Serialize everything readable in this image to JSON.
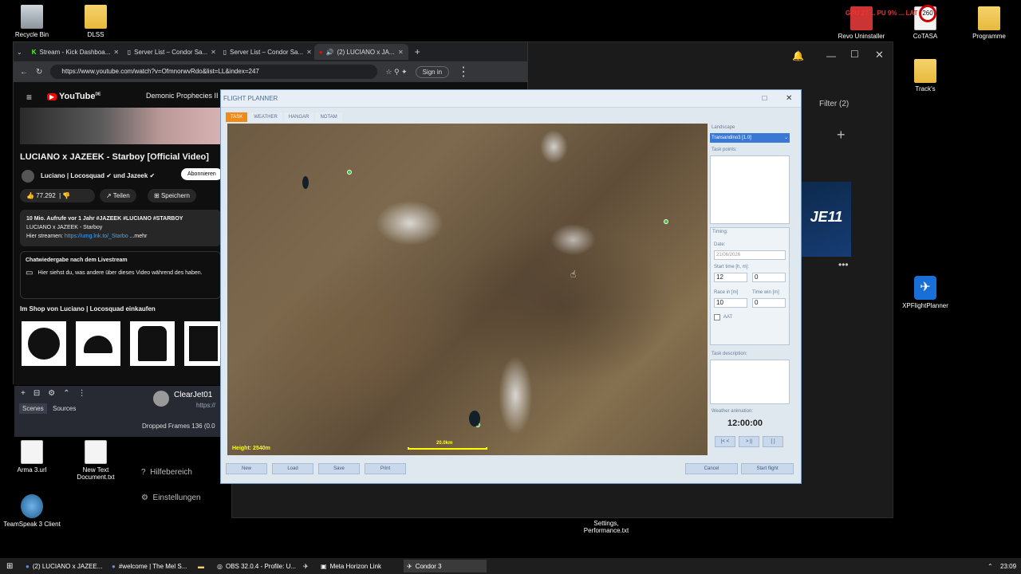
{
  "desktop": {
    "icons_left": [
      "Recycle Bin",
      "DLSS",
      "Arma 3.url",
      "New Text Document.txt",
      "TeamSpeak 3 Client"
    ],
    "icons_top_right": [
      "Revo Uninstaller",
      "CoTASA",
      "Programme"
    ],
    "icons_right": [
      "Track's",
      "XPFlightPlanner"
    ],
    "settings_file": "Settings, Performance.txt",
    "overlay_stats": "GPU 27 ... PU 9% ... LAT N/A",
    "badge_number": "260"
  },
  "browser": {
    "tabs": [
      {
        "label": "Stream - Kick Dashboa..."
      },
      {
        "label": "Server List – Condor Sa..."
      },
      {
        "label": "Server List – Condor Sa..."
      },
      {
        "label": "(2) LUCIANO x JA..."
      }
    ],
    "url": "https://www.youtube.com/watch?v=OfmnorwvRdo&list=LL&index=247",
    "sign_in": "Sign in"
  },
  "youtube": {
    "logo": "YouTube",
    "logo_region": "DE",
    "playlist_title": "Demonic Prophecies II",
    "video_title": "LUCIANO x JAZEEK - Starboy [Official Video]",
    "channel": "Luciano | Locosquad ✔ und Jazeek ✔",
    "subscribe": "Abonnieren",
    "likes": "77.292",
    "share": "Teilen",
    "save": "Speichern",
    "desc_line1": "10 Mio. Aufrufe  vor 1 Jahr  #JAZEEK #LUCIANO #STARBOY",
    "desc_line2": "LUCIANO x JAZEEK - Starboy",
    "desc_line3_prefix": "Hier streamen: ",
    "desc_link": "https://umg.lnk.to/_Starbo",
    "desc_more": "...mehr",
    "chat_replay_title": "Chatwiedergabe nach dem Livestream",
    "chat_replay_text": "Hier siehst du, was andere über dieses Video während des haben.",
    "shop_title": "Im Shop von Luciano | Locosquad einkaufen"
  },
  "obs": {
    "scenes": "Scenes",
    "sources": "Sources",
    "dropped_frames": "Dropped Frames 136 (0.0",
    "chat_user": "ClearJet01",
    "chat_link": "https://"
  },
  "darkapp": {
    "filter": "Filter (2)",
    "banner_text": "JE11",
    "help": "Hilfebereich",
    "settings": "Einstellungen"
  },
  "flight_planner": {
    "title": "FLIGHT PLANNER",
    "tabs": [
      "TASK",
      "WEATHER",
      "HANGAR",
      "NOTAM"
    ],
    "map_height": "Height: 2540m",
    "map_scale": "20.0km",
    "landscape_label": "Landscape",
    "landscape_value": "Transandino3 [1.0]",
    "task_points_label": "Task points:",
    "timing_label": "Timing:",
    "date_label": "Date:",
    "date_value": "21/06/2026",
    "start_time_label": "Start time [h, m]:",
    "start_h": "12",
    "start_m": "0",
    "race_in_label": "Race in [m]",
    "race_in_value": "10",
    "time_win_label": "Time win [m]",
    "time_win_value": "0",
    "aat_label": "AAT",
    "task_desc_label": "Task description:",
    "weather_anim_label": "Weather animation:",
    "weather_time": "12:00:00",
    "anim_buttons": [
      "|< <",
      "> ||",
      "[ ]"
    ],
    "buttons": {
      "new": "New",
      "load": "Load",
      "save": "Save",
      "print": "Print",
      "cancel": "Cancel",
      "start_flight": "Start flight"
    }
  },
  "taskbar": {
    "items": [
      "(2) LUCIANO x JAZEE...",
      "#welcome | The Mel S...",
      "OBS 32.0.4 - Profile: U...",
      "Meta Horizon Link",
      "Condor 3"
    ],
    "clock": "23:09"
  },
  "colors": {
    "accent_orange": "#f08a18",
    "youtube_red": "#ff0000",
    "fp_blue": "#c9d8ea"
  }
}
